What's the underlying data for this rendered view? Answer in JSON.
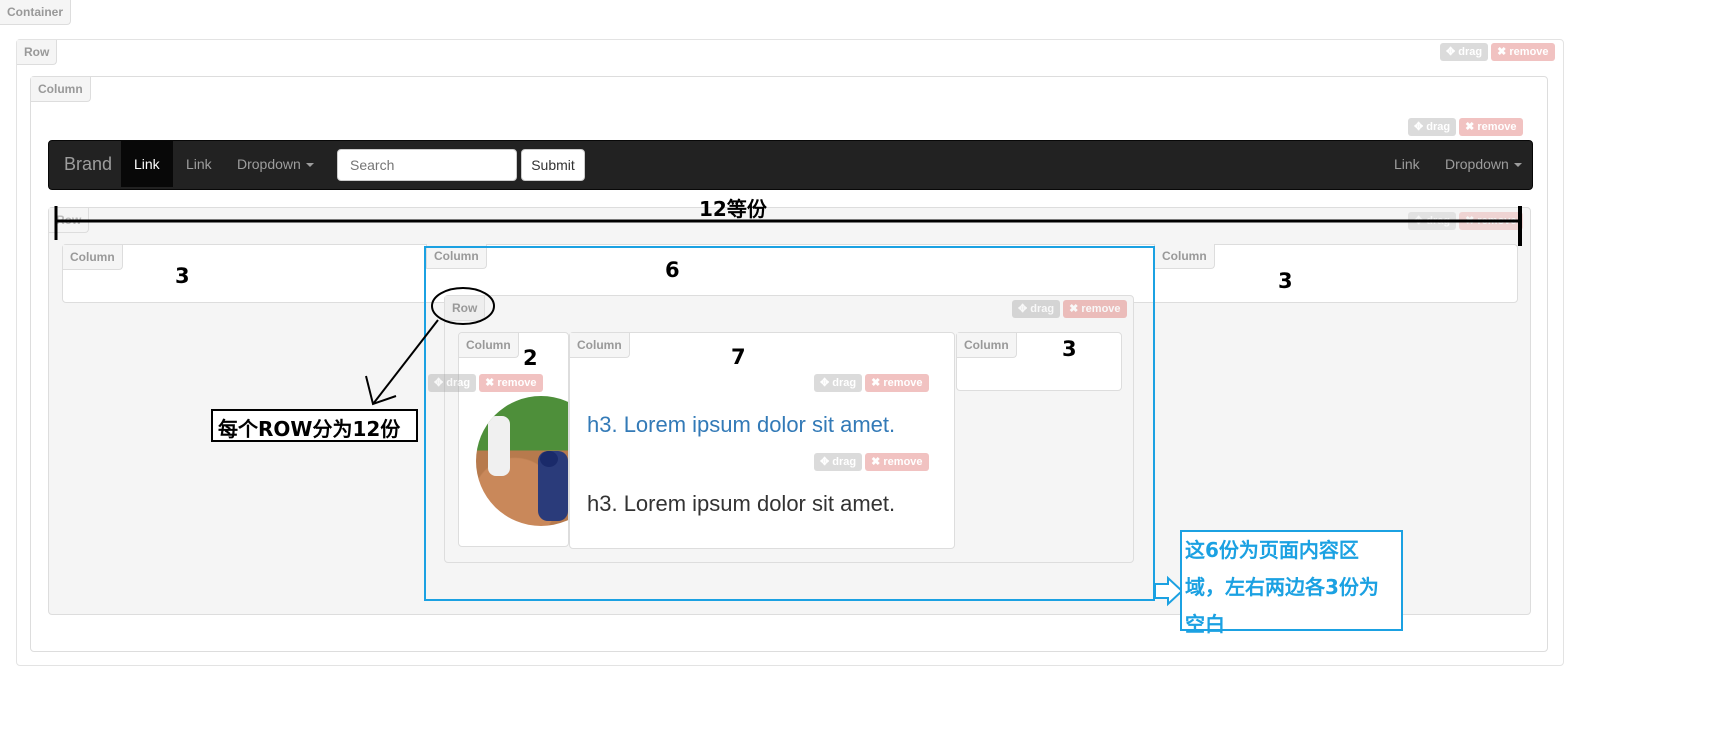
{
  "labels": {
    "container": "Container",
    "row": "Row",
    "column": "Column",
    "drag": "drag",
    "remove": "remove"
  },
  "navbar": {
    "brand": "Brand",
    "link_active": "Link",
    "link": "Link",
    "dropdown": "Dropdown",
    "search_placeholder": "Search",
    "submit": "Submit",
    "right_link": "Link",
    "right_dropdown": "Dropdown"
  },
  "content": {
    "heading_link": "h3. Lorem ipsum dolor sit amet.",
    "heading_plain": "h3. Lorem ipsum dolor sit amet."
  },
  "annotations": {
    "twelve_parts": "12等份",
    "col_left": "3",
    "col_mid": "6",
    "col_right": "3",
    "inner_left": "2",
    "inner_mid": "7",
    "inner_right": "3",
    "row_note": "每个ROW分为12份",
    "content_note_line1": "这6份为页面内容区",
    "content_note_line2": "域，左右两边各3份为",
    "content_note_line3": "空白"
  },
  "colors": {
    "annotation_blue": "#1ba1e2",
    "link_blue": "#337ab7",
    "navbar_bg": "#222222"
  }
}
